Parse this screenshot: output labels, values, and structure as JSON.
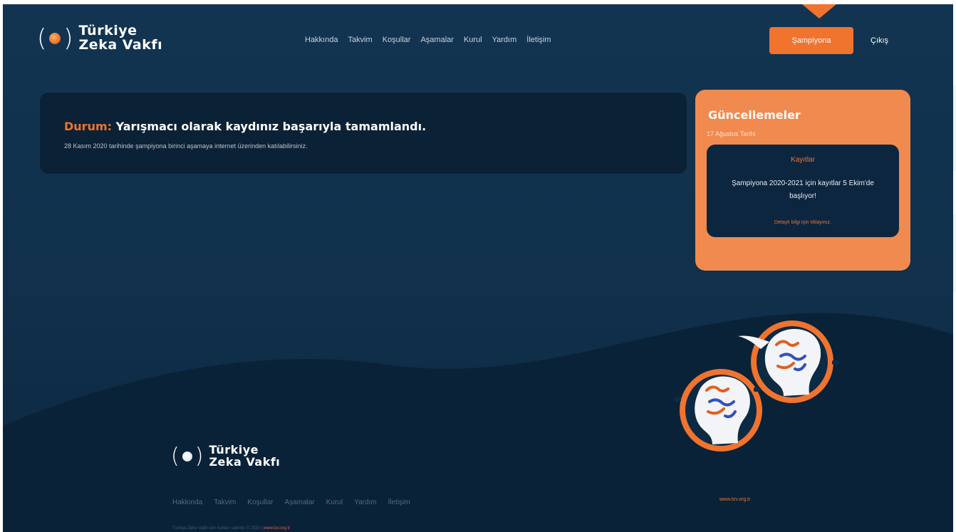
{
  "window": {
    "title": "Türkiye Zeka Vakfı"
  },
  "brand": {
    "line1": "Türkiye",
    "line2": "Zeka Vakfı",
    "logo_icon": "brain-dot-logo"
  },
  "nav": {
    "items": [
      {
        "label": "Hakkında"
      },
      {
        "label": "Takvim"
      },
      {
        "label": "Koşullar"
      },
      {
        "label": "Aşamalar"
      },
      {
        "label": "Kurul"
      },
      {
        "label": "Yardım"
      },
      {
        "label": "İletişim"
      }
    ],
    "cta_label": "Şampiyona",
    "logout_label": "Çıkış"
  },
  "status": {
    "label": "Durum:",
    "message": "Yarışmacı olarak kaydınız başarıyla tamamlandı.",
    "sub": "28 Kasım 2020 tarihinde şampiyona birinci aşamaya internet üzerinden katılabilirsiniz."
  },
  "updates": {
    "title": "Güncellemeler",
    "date": "17 Ağustos Tarihi",
    "card": {
      "title": "Kayıtlar",
      "body": "Şampiyona 2020-2021 için kayıtlar 5 Ekim'de başlıyor!",
      "link": "Detaylı bilgi için tıklayınız."
    }
  },
  "footer": {
    "nav": [
      "Hakkında",
      "Takvim",
      "Koşullar",
      "Aşamalar",
      "Kurul",
      "Yardım",
      "İletişim"
    ],
    "url": "www.tzv.org.tr",
    "copyright": "Türkiye Zeka Vakfı tüm hakları saklıdır © 2020 |",
    "copyright_link": "www.tzv.org.tr"
  },
  "colors": {
    "accent": "#f0732e",
    "panel": "#f08a4e",
    "background": "#123451",
    "card": "#0b2135"
  }
}
